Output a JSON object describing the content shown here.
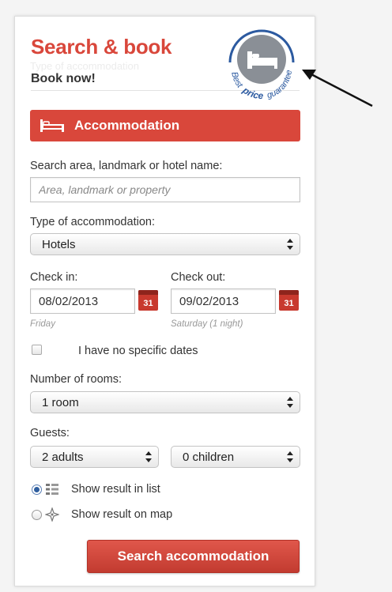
{
  "header": {
    "title": "Search & book",
    "subtitle": "Book now!",
    "ghost_text": "Type of accommodation"
  },
  "badge": {
    "text_best": "Best",
    "text_price": "price",
    "text_guaranteed": "guaranteed",
    "icon": "bed-icon"
  },
  "section": {
    "label": "Accommodation",
    "icon": "bed-icon"
  },
  "search": {
    "label": "Search area, landmark or hotel name:",
    "placeholder": "Area, landmark or property"
  },
  "type": {
    "label": "Type of accommodation:",
    "selected": "Hotels"
  },
  "checkin": {
    "label": "Check in:",
    "value": "08/02/2013",
    "calendar_day": "31",
    "hint": "Friday"
  },
  "checkout": {
    "label": "Check out:",
    "value": "09/02/2013",
    "calendar_day": "31",
    "hint": "Saturday (1 night)"
  },
  "no_dates": {
    "label": "I have no specific dates",
    "checked": false
  },
  "rooms": {
    "label": "Number of rooms:",
    "selected": "1 room"
  },
  "guests": {
    "label": "Guests:",
    "adults": "2 adults",
    "children": "0 children"
  },
  "view_options": {
    "list_label": "Show result in list",
    "map_label": "Show result on map",
    "selected": "list"
  },
  "submit": {
    "label": "Search accommodation"
  },
  "colors": {
    "accent_red": "#d9473b",
    "badge_blue": "#2c5aa0",
    "badge_grey": "#8a8f96"
  }
}
